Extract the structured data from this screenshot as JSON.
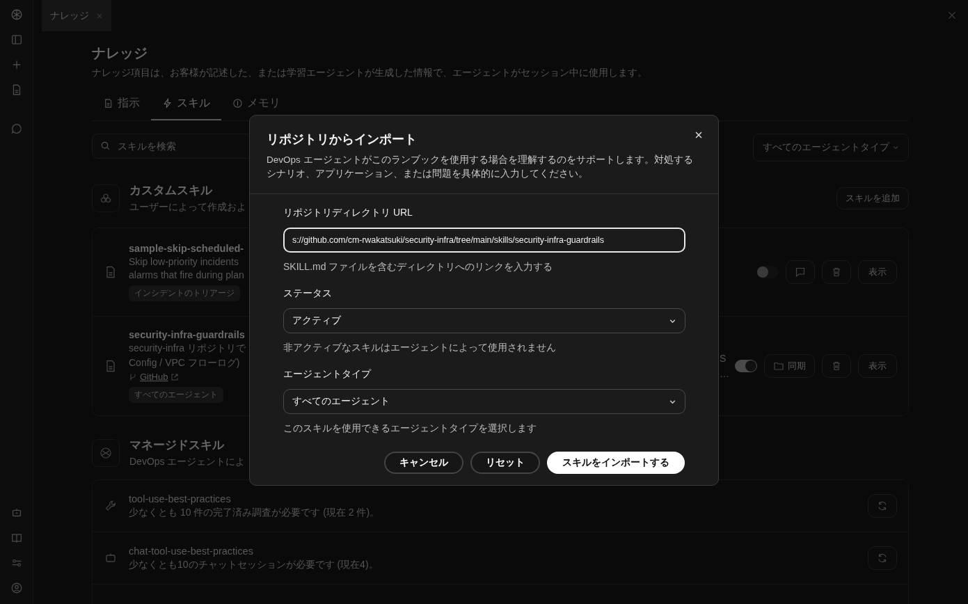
{
  "tab_bar": {
    "tabs": [
      {
        "label": "ナレッジ",
        "selected": true
      }
    ]
  },
  "page": {
    "title": "ナレッジ",
    "subtitle": "ナレッジ項目は、お客様が記述した、または学習エージェントが生成した情報で、エージェントがセッション中に使用します。"
  },
  "tabs": [
    {
      "label": "指示",
      "selected": false
    },
    {
      "label": "スキル",
      "selected": true
    },
    {
      "label": "メモリ",
      "selected": false
    }
  ],
  "search": {
    "placeholder": "スキルを検索"
  },
  "agent_filter": {
    "value": "すべてのエージェントタイプ"
  },
  "custom_skills": {
    "title": "カスタムスキル",
    "subtitle": "ユーザーによって作成およ",
    "add_button": "スキルを追加",
    "items": [
      {
        "name": "sample-skip-scheduled-",
        "description": [
          "Skip low-priority incidents",
          "alarms that fire during plan"
        ],
        "tag": "インシデントのトリアージ",
        "enabled": false,
        "kind": "comment",
        "view_label": "表示"
      },
      {
        "name": "security-infra-guardrails",
        "description": [
          "security-infra リポジトリで",
          "Config / VPC フローログ)"
        ],
        "description_tail": [
          "S",
          "…"
        ],
        "link": "GitHub",
        "tag": "すべてのエージェント",
        "enabled": true,
        "kind": "sync",
        "sync_label": "同期",
        "view_label": "表示"
      }
    ]
  },
  "managed_skills": {
    "title": "マネージドスキル",
    "subtitle": "DevOps エージェントによ",
    "items": [
      {
        "name": "tool-use-best-practices",
        "description": "少なくとも 10 件の完了済み調査が必要です (現在 2 件)。",
        "kind": "wrench"
      },
      {
        "name": "chat-tool-use-best-practices",
        "description": "少なくとも10のチャットセッションが必要です (現在4)。",
        "kind": "chat"
      }
    ]
  },
  "dialog": {
    "title": "リポジトリからインポート",
    "description": "DevOps エージェントがこのランブックを使用する場合を理解するのをサポートします。対処するシナリオ、アプリケーション、または問題を具体的に入力してください。",
    "fields": [
      {
        "label": "リポジトリディレクトリ URL",
        "kind": "text",
        "value": "s://github.com/cm-rwakatsuki/security-infra/tree/main/skills/security-infra-guardrails",
        "hint": "SKILL.md ファイルを含むディレクトリへのリンクを入力する",
        "focused": true
      },
      {
        "label": "ステータス",
        "kind": "select",
        "value": "アクティブ",
        "hint": "非アクティブなスキルはエージェントによって使用されません",
        "focused": false
      },
      {
        "label": "エージェントタイプ",
        "kind": "select",
        "value": "すべてのエージェント",
        "hint": "このスキルを使用できるエージェントタイプを選択します",
        "focused": false
      }
    ],
    "buttons": [
      {
        "label": "キャンセル",
        "primary": false
      },
      {
        "label": "リセット",
        "primary": false
      },
      {
        "label": "スキルをインポートする",
        "primary": true
      }
    ]
  }
}
